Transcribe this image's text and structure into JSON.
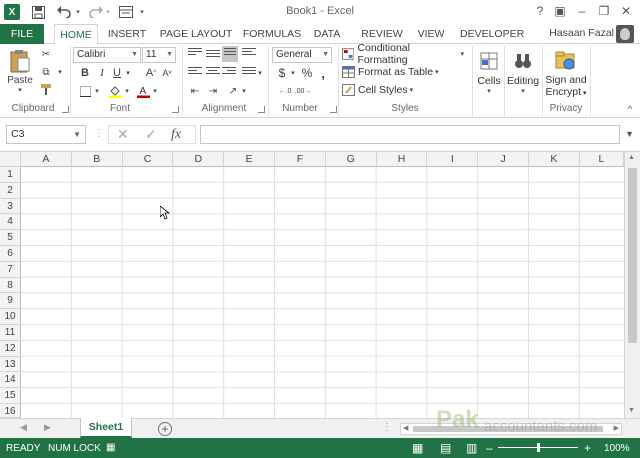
{
  "window": {
    "title": "Book1 - Excel",
    "icons": [
      "excel-logo",
      "save-icon",
      "undo-icon",
      "redo-icon",
      "customize-icon"
    ]
  },
  "tabs": [
    "FILE",
    "HOME",
    "INSERT",
    "PAGE LAYOUT",
    "FORMULAS",
    "DATA",
    "REVIEW",
    "VIEW",
    "DEVELOPER"
  ],
  "active_tab": "HOME",
  "user": {
    "name": "Hasaan Fazal"
  },
  "ribbon": {
    "clipboard": {
      "label": "Clipboard",
      "paste_label": "Paste"
    },
    "font": {
      "label": "Font",
      "font_name": "Calibri",
      "font_size": "11"
    },
    "alignment": {
      "label": "Alignment"
    },
    "number": {
      "label": "Number",
      "format": "General"
    },
    "styles": {
      "label": "Styles",
      "conditional_formatting": "Conditional Formatting",
      "format_as_table": "Format as Table",
      "cell_styles": "Cell Styles"
    },
    "cells": {
      "label": "Cells"
    },
    "editing": {
      "label": "Editing"
    },
    "privacy": {
      "label": "Privacy",
      "sign_encrypt_1": "Sign and",
      "sign_encrypt_2": "Encrypt"
    }
  },
  "formula_bar": {
    "name_box": "C3",
    "fx": "fx",
    "value": ""
  },
  "grid": {
    "columns": [
      "A",
      "B",
      "C",
      "D",
      "E",
      "F",
      "G",
      "H",
      "I",
      "J",
      "K",
      "L"
    ],
    "rows": [
      "1",
      "2",
      "3",
      "4",
      "5",
      "6",
      "7",
      "8",
      "9",
      "10",
      "11",
      "12",
      "13",
      "14",
      "15",
      "16"
    ]
  },
  "sheets": [
    "Sheet1"
  ],
  "active_sheet": "Sheet1",
  "status": {
    "ready": "READY",
    "num_lock": "NUM LOCK",
    "zoom": "100%"
  },
  "watermark": {
    "brand": "Pak",
    "site": "accountants.com"
  },
  "colors": {
    "accent": "#217346",
    "font_color": "#c00000",
    "fill_color": "#ffff00"
  }
}
